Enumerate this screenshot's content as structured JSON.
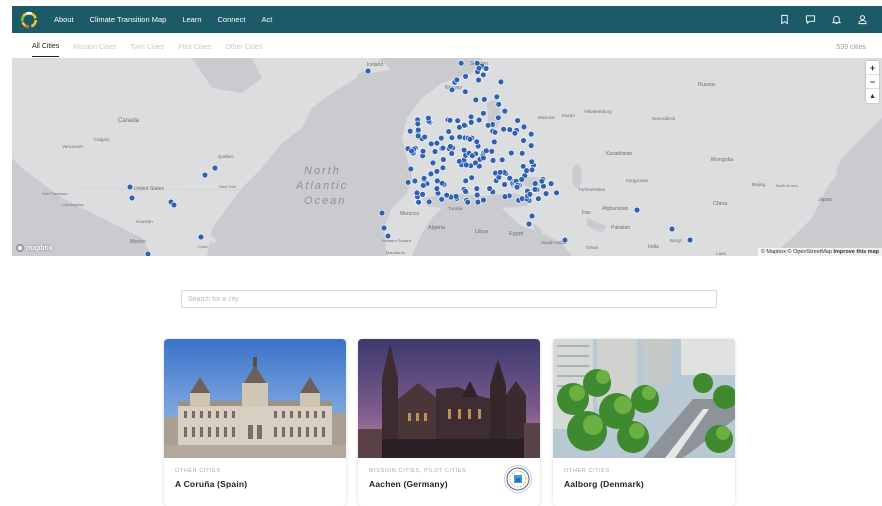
{
  "nav": {
    "links": [
      "About",
      "Climate Transition Map",
      "Learn",
      "Connect",
      "Act"
    ],
    "icons": [
      "bookmark-icon",
      "chat-icon",
      "bell-icon",
      "user-icon"
    ]
  },
  "tabs": {
    "items": [
      "All Cities",
      "Mission Cities",
      "Twin Cities",
      "Pilot Cities",
      "Other Cities"
    ],
    "active": "All Cities",
    "count": "539 cities"
  },
  "map": {
    "labels": {
      "iceland": "Iceland",
      "sweden": "Sweden",
      "norway": "Norway",
      "canada": "Canada",
      "russia": "Russia",
      "calgary": "Calgary",
      "vancouver": "Vancouver",
      "quebec": "Québec",
      "us": "United States",
      "sf": "San Francisco",
      "la": "Los Angeles",
      "ny": "New York",
      "houston": "Houston",
      "mexico": "Mexico",
      "cuba": "Cuba",
      "ocean1": "North",
      "ocean2": "Atlantic",
      "ocean3": "Ocean",
      "moscow": "Moscow",
      "kazan": "Kazan",
      "yekaterinburg": "Yekaterinburg",
      "novosibirsk": "Novosibirsk",
      "kazakhstan": "Kazakhstan",
      "mongolia": "Mongolia",
      "kyrgyzstan": "Kyrgyzstan",
      "turkmenistan": "Turkmenistan",
      "beijing": "Beijing",
      "northkorea": "North Korea",
      "japan": "Japan",
      "china": "China",
      "afghanistan": "Afghanistan",
      "iran": "Iran",
      "pakistan": "Pakistan",
      "india": "India",
      "morocco": "Morocco",
      "algeria": "Algeria",
      "libya": "Libya",
      "egypt": "Egypt",
      "tunisia": "Tunisia",
      "saudi": "Saudi Arabia",
      "oman": "Oman",
      "bangladesh": "Bangl",
      "western_sahara": "Western Sahara",
      "mauritania": "Mauritania",
      "laos": "Laos"
    },
    "zoom_in": "+",
    "zoom_out": "−",
    "compass": "▲",
    "logo": "mapbox",
    "attribution": "© Mapbox © OpenStreetMap",
    "improve": "Improve this map"
  },
  "search": {
    "placeholder": "Search for a city"
  },
  "cards": [
    {
      "category": "Other Cities",
      "name": "A Coruña (Spain)"
    },
    {
      "category": "Mission Cities, Pilot Cities",
      "name": "Aachen (Germany)"
    },
    {
      "category": "Other Cities",
      "name": "Aalborg (Denmark)"
    }
  ],
  "colors": {
    "nav": "#1b5a66",
    "dot": "#2f61b3",
    "map_land": "#dcdddf",
    "map_water": "#c8cacd"
  }
}
